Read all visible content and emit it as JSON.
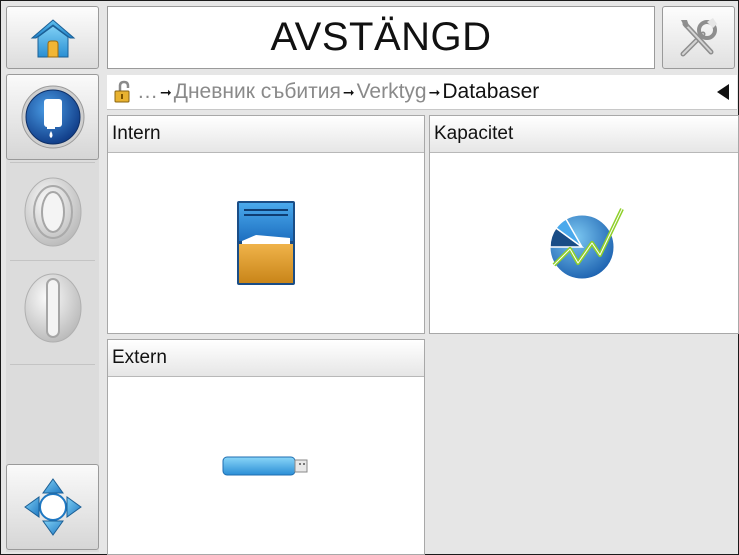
{
  "header": {
    "status_text": "AVSTÄNGD",
    "home_icon": "home-icon",
    "tools_icon": "tools-icon"
  },
  "sidebar": {
    "items": [
      {
        "icon": "ink-bottle-icon",
        "active": true
      },
      {
        "icon": "oval-indicator-icon",
        "active": false
      },
      {
        "icon": "bar-indicator-icon",
        "active": false
      },
      {
        "icon": "navigation-arrows-icon",
        "active": false
      }
    ]
  },
  "breadcrumb": {
    "lock_icon": "padlock-open-icon",
    "ellipsis": "…",
    "items": [
      "Дневник събития",
      "Verktyg",
      "Databaser"
    ],
    "back_icon": "back-triangle-icon"
  },
  "tiles": [
    {
      "label": "Intern",
      "icon": "internal-storage-icon"
    },
    {
      "label": "Kapacitet",
      "icon": "capacity-chart-icon"
    },
    {
      "label": "Extern",
      "icon": "usb-drive-icon"
    }
  ],
  "colors": {
    "accent_blue": "#1e5fb0",
    "folder_orange": "#d99a2b",
    "background": "#e6e6e6"
  }
}
